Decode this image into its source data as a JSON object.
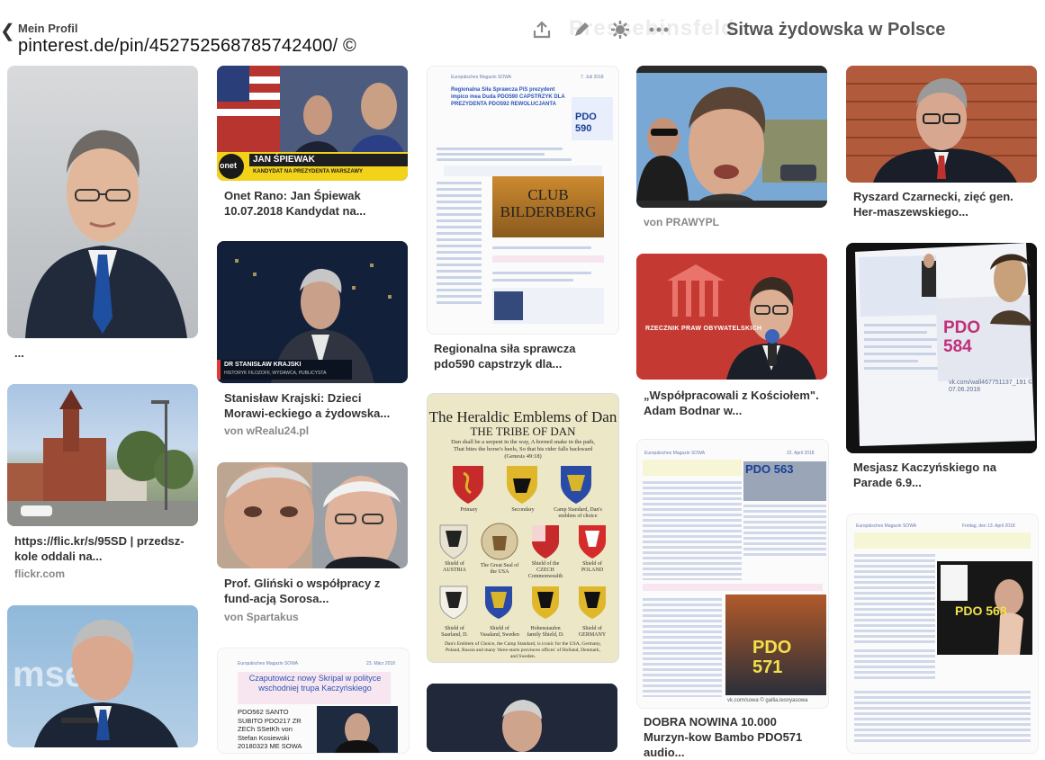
{
  "header": {
    "back_label": "Mein Profil",
    "url": "pinterest.de/pin/452752568785742400/ ©",
    "watermark": "Pressebinsfeld",
    "board_title": "Sitwa żydowska w Polsce",
    "icons": [
      "share-icon",
      "edit-icon",
      "settings-icon",
      "more-icon"
    ]
  },
  "pins": [
    {
      "caption": "...",
      "source": ""
    },
    {
      "caption": "https://flic.kr/s/95SD | przedsz-kole oddali na...",
      "source": "flickr.com"
    },
    {
      "caption": "",
      "source": ""
    },
    {
      "caption": "Onet Rano: Jan Śpiewak 10.07.2018 Kandydat na...",
      "source": "",
      "img_text": {
        "name": "JAN ŚPIEWAK",
        "sub": "KANDYDAT NA PREZYDENTA WARSZAWY",
        "logo": "onet"
      }
    },
    {
      "caption": "Stanisław Krajski: Dzieci Morawi-eckiego a żydowska...",
      "source": "von wRealu24.pl",
      "img_text": {
        "name": "DR STANISŁAW KRAJSKI",
        "sub": "HISTORYK FILOZOFII, WYDAWCA, PUBLICYSTA"
      }
    },
    {
      "caption": "Prof. Gliński o współpracy z fund-acją Sorosa...",
      "source": "von Spartakus"
    },
    {
      "caption": "",
      "source": "",
      "img_text": {
        "title": "Czaputowicz nowy Skripal w polityce wschodniej trupa Kaczyńskiego",
        "body": "PDO562 SANTO SUBITO PDO217 ZR ZECh SSetKh von Stefan Kosiewski 20180323 ME SOWA",
        "date": "23. März 2018",
        "brand": "Europäisches Magazin SOWA"
      }
    },
    {
      "caption": "Regionalna siła sprawcza pdo590 capstrzyk dla...",
      "source": "",
      "img_text": {
        "brand": "Europäisches Magazin SOWA",
        "date": "7. Juli 2018",
        "title": "Regionalna Siła Sprawcza PiS prezydent impico mea Duda PDO590 CAPSTRZYK DLA PREZYDENTA PDO592 REWOLUCJANTA",
        "pdo": "PDO 590",
        "club": "CLUB BILDERBERG"
      }
    },
    {
      "caption": "",
      "source": "",
      "img_text": {
        "title": "The Heraldic Emblems of Dan",
        "subtitle": "THE TRIBE OF DAN",
        "quote": "Dan shall be a serpent in the way, A horned snake in the path, That bites the horse's heels, So that his rider falls backward (Genesis 49:18)",
        "shields": [
          "Primary",
          "Secondary",
          "Camp Standard, Dan's emblem of choice",
          "Shield of AUSTRIA",
          "The Great Seal of the USA",
          "Shield of the CZECH Commonwealth",
          "Shield of POLAND",
          "Shield of Saarland, D.",
          "Shield of Vasaland, Sweden",
          "Hohenstaufen family Shield, D.",
          "Shield of GERMANY"
        ],
        "footer": "Dan's Emblem of Choice, the Camp Standard, is iconic for the USA, Germany, Poland, Russia and many 'three-starts provinces offices' of Holland, Denmark, and Sweden."
      }
    },
    {
      "caption": "",
      "source": ""
    },
    {
      "caption": "",
      "source": "von PRAWYPL"
    },
    {
      "caption": "„Współpracowali z Kościołem\". Adam Bodnar w...",
      "source": "",
      "img_text": {
        "sign": "RZECZNIK PRAW OBYWATELSKICH"
      }
    },
    {
      "caption": "DOBRA NOWINA 10.000 Murzyn-kow Bambo PDO571 audio...",
      "source": "",
      "img_text": {
        "brand": "Europäisches Magazin SOWA",
        "date": "22. April 2018",
        "pdo_top": "PDO 563",
        "pdo": "PDO 571",
        "footer": "vk.com/sowa  © gallia.lesnyasowa"
      }
    },
    {
      "caption": "Ryszard Czarnecki, zięć gen. Her-maszewskiego...",
      "source": ""
    },
    {
      "caption": "Mesjasz Kaczyńskiego na Parade 6.9...",
      "source": "",
      "img_text": {
        "pdo": "PDO 584",
        "footer": "vk.com/wall467751137_191 © 07.06.2018"
      }
    },
    {
      "caption": "",
      "source": "",
      "img_text": {
        "brand": "Europäisches Magazin SOWA",
        "date": "Freitag, den 13. April 2018",
        "pdo": "PDO 568"
      }
    }
  ]
}
